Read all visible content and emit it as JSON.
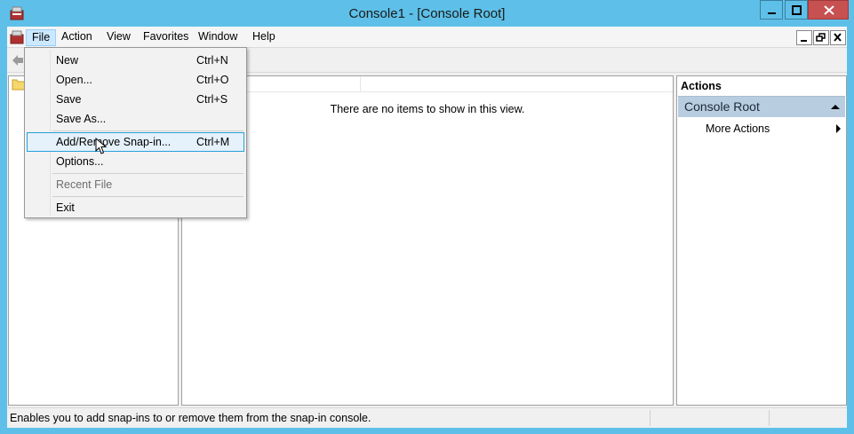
{
  "window": {
    "title": "Console1 - [Console Root]",
    "controls": {
      "minimize": "minimize",
      "maximize": "maximize",
      "close": "close"
    }
  },
  "menubar": {
    "items": [
      {
        "label": "File"
      },
      {
        "label": "Action"
      },
      {
        "label": "View"
      },
      {
        "label": "Favorites"
      },
      {
        "label": "Window"
      },
      {
        "label": "Help"
      }
    ]
  },
  "file_menu": {
    "items": [
      {
        "label": "New",
        "shortcut": "Ctrl+N"
      },
      {
        "label": "Open...",
        "shortcut": "Ctrl+O"
      },
      {
        "label": "Save",
        "shortcut": "Ctrl+S"
      },
      {
        "label": "Save As...",
        "shortcut": ""
      },
      {
        "label": "Add/Remove Snap-in...",
        "shortcut": "Ctrl+M",
        "highlighted": true
      },
      {
        "label": "Options...",
        "shortcut": ""
      },
      {
        "label": "Recent File",
        "shortcut": "",
        "disabled": true
      },
      {
        "label": "Exit",
        "shortcut": ""
      }
    ]
  },
  "result_pane": {
    "empty_message": "There are no items to show in this view."
  },
  "actions_pane": {
    "title": "Actions",
    "group_label": "Console Root",
    "more_actions": "More Actions"
  },
  "statusbar": {
    "text": "Enables you to add snap-ins to or remove them from the snap-in console."
  },
  "colors": {
    "titlebar": "#5ec0e8",
    "close_button": "#c75050",
    "menu_highlight": "#cce8ff",
    "item_highlight_border": "#26a0da",
    "actions_group": "#b9cde0"
  }
}
